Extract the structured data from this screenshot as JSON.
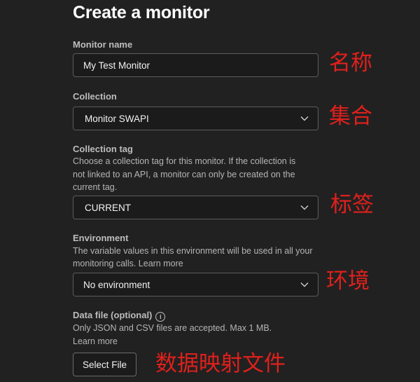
{
  "form": {
    "title": "Create a monitor",
    "monitor_name": {
      "label": "Monitor name",
      "value": "My Test Monitor"
    },
    "collection": {
      "label": "Collection",
      "selected": "Monitor SWAPI"
    },
    "collection_tag": {
      "label": "Collection tag",
      "help_line1": "Choose a collection tag for this monitor. If the collection is",
      "help_line2": "not linked to an API, a monitor can only be created on the",
      "help_line3": "current tag.",
      "selected": "CURRENT"
    },
    "environment": {
      "label": "Environment",
      "help_line1": "The variable values in this environment will be used in all your",
      "help_line2": "monitoring calls. Learn more",
      "selected": "No environment"
    },
    "data_file": {
      "label": "Data file (optional)",
      "info_glyph": "i",
      "help_line1": "Only JSON and CSV files are accepted. Max 1 MB.",
      "help_line2": "Learn more",
      "button_label": "Select File"
    }
  },
  "annotations": {
    "name": "名称",
    "collection": "集合",
    "tag": "标签",
    "environment": "环境",
    "data_file": "数据映射文件"
  },
  "icons": {
    "dropdown": "chevron-down-icon",
    "info": "info-icon"
  },
  "colors": {
    "background": "#212121",
    "annotation": "#e0201c",
    "field_border": "#5c5c5c"
  }
}
